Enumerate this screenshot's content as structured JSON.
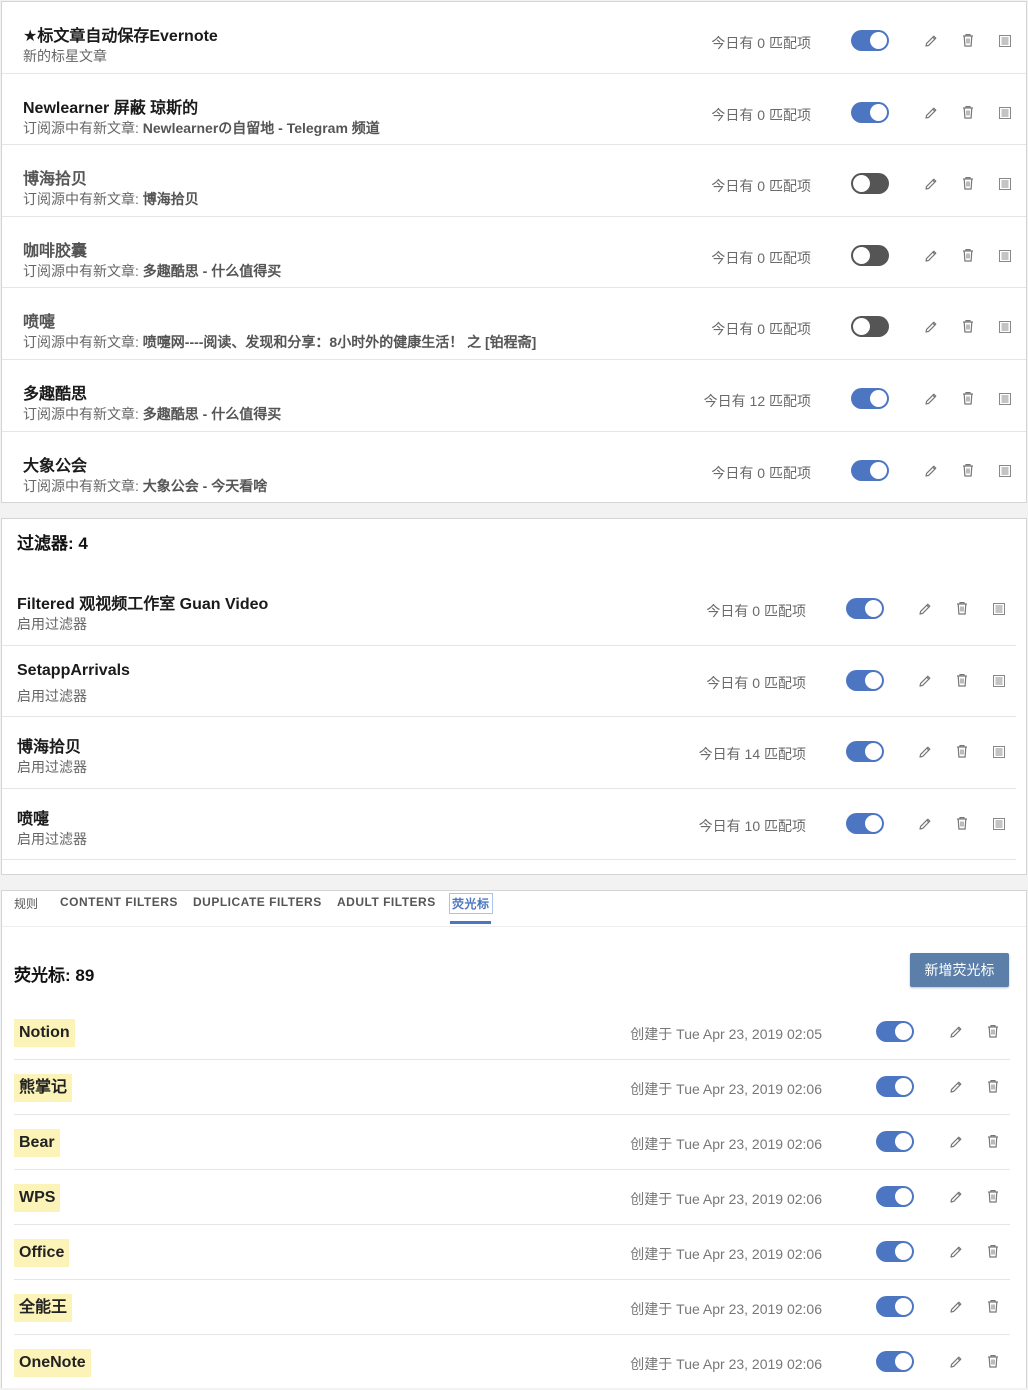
{
  "colors": {
    "accent": "#4c76c2",
    "toggle_off": "#555555",
    "highlight_bg": "#fbf3b8",
    "button_bg": "#5b7fa9"
  },
  "rules": [
    {
      "title": "★标文章自动保存Evernote",
      "sub_prefix": "新的标星文章",
      "sub_bold": "",
      "count": "今日有 0 匹配项",
      "enabled": true,
      "dim": false
    },
    {
      "title": "Newlearner 屏蔽 琼斯的",
      "sub_prefix": "订阅源中有新文章: ",
      "sub_bold": "Newlearnerの自留地 - Telegram 频道",
      "count": "今日有 0 匹配项",
      "enabled": true,
      "dim": false
    },
    {
      "title": "博海拾贝",
      "sub_prefix": "订阅源中有新文章: ",
      "sub_bold": "博海拾贝",
      "count": "今日有 0 匹配项",
      "enabled": false,
      "dim": true
    },
    {
      "title": "咖啡胶囊",
      "sub_prefix": "订阅源中有新文章: ",
      "sub_bold": "多趣酷思 - 什么值得买",
      "count": "今日有 0 匹配项",
      "enabled": false,
      "dim": true
    },
    {
      "title": "喷嚏",
      "sub_prefix": "订阅源中有新文章: ",
      "sub_bold": "喷嚏网----阅读、发现和分享：8小时外的健康生活！ 之 [铂程斋]",
      "count": "今日有 0 匹配项",
      "enabled": false,
      "dim": true
    },
    {
      "title": "多趣酷思",
      "sub_prefix": "订阅源中有新文章: ",
      "sub_bold": "多趣酷思 - 什么值得买",
      "count": "今日有 12 匹配项",
      "enabled": true,
      "dim": false
    },
    {
      "title": "大象公会",
      "sub_prefix": "订阅源中有新文章: ",
      "sub_bold": "大象公会 - 今天看啥",
      "count": "今日有 0 匹配项",
      "enabled": true,
      "dim": false
    }
  ],
  "filters_section": {
    "title": "过滤器: 4",
    "items": [
      {
        "title": "Filtered 观视频工作室 Guan Video",
        "sub": "启用过滤器",
        "count": "今日有 0 匹配项",
        "enabled": true
      },
      {
        "title": "SetappArrivals",
        "sub": "启用过滤器",
        "count": "今日有 0 匹配项",
        "enabled": true
      },
      {
        "title": "博海拾贝",
        "sub": "启用过滤器",
        "count": "今日有 14 匹配项",
        "enabled": true
      },
      {
        "title": "喷嚏",
        "sub": "启用过滤器",
        "count": "今日有 10 匹配项",
        "enabled": true
      }
    ]
  },
  "tabs": [
    {
      "label": "规则",
      "active": false
    },
    {
      "label": "CONTENT FILTERS",
      "active": false
    },
    {
      "label": "DUPLICATE FILTERS",
      "active": false
    },
    {
      "label": "ADULT FILTERS",
      "active": false
    },
    {
      "label": "荧光标",
      "active": true
    }
  ],
  "highlights_section": {
    "title": "荧光标: 89",
    "add_button_label": "新增荧光标",
    "items": [
      {
        "tag": "Notion",
        "date": "创建于 Tue Apr 23, 2019 02:05",
        "enabled": true
      },
      {
        "tag": "熊掌记",
        "date": "创建于 Tue Apr 23, 2019 02:06",
        "enabled": true
      },
      {
        "tag": "Bear",
        "date": "创建于 Tue Apr 23, 2019 02:06",
        "enabled": true
      },
      {
        "tag": "WPS",
        "date": "创建于 Tue Apr 23, 2019 02:06",
        "enabled": true
      },
      {
        "tag": "Office",
        "date": "创建于 Tue Apr 23, 2019 02:06",
        "enabled": true
      },
      {
        "tag": "全能王",
        "date": "创建于 Tue Apr 23, 2019 02:06",
        "enabled": true
      },
      {
        "tag": "OneNote",
        "date": "创建于 Tue Apr 23, 2019 02:06",
        "enabled": true
      }
    ]
  }
}
